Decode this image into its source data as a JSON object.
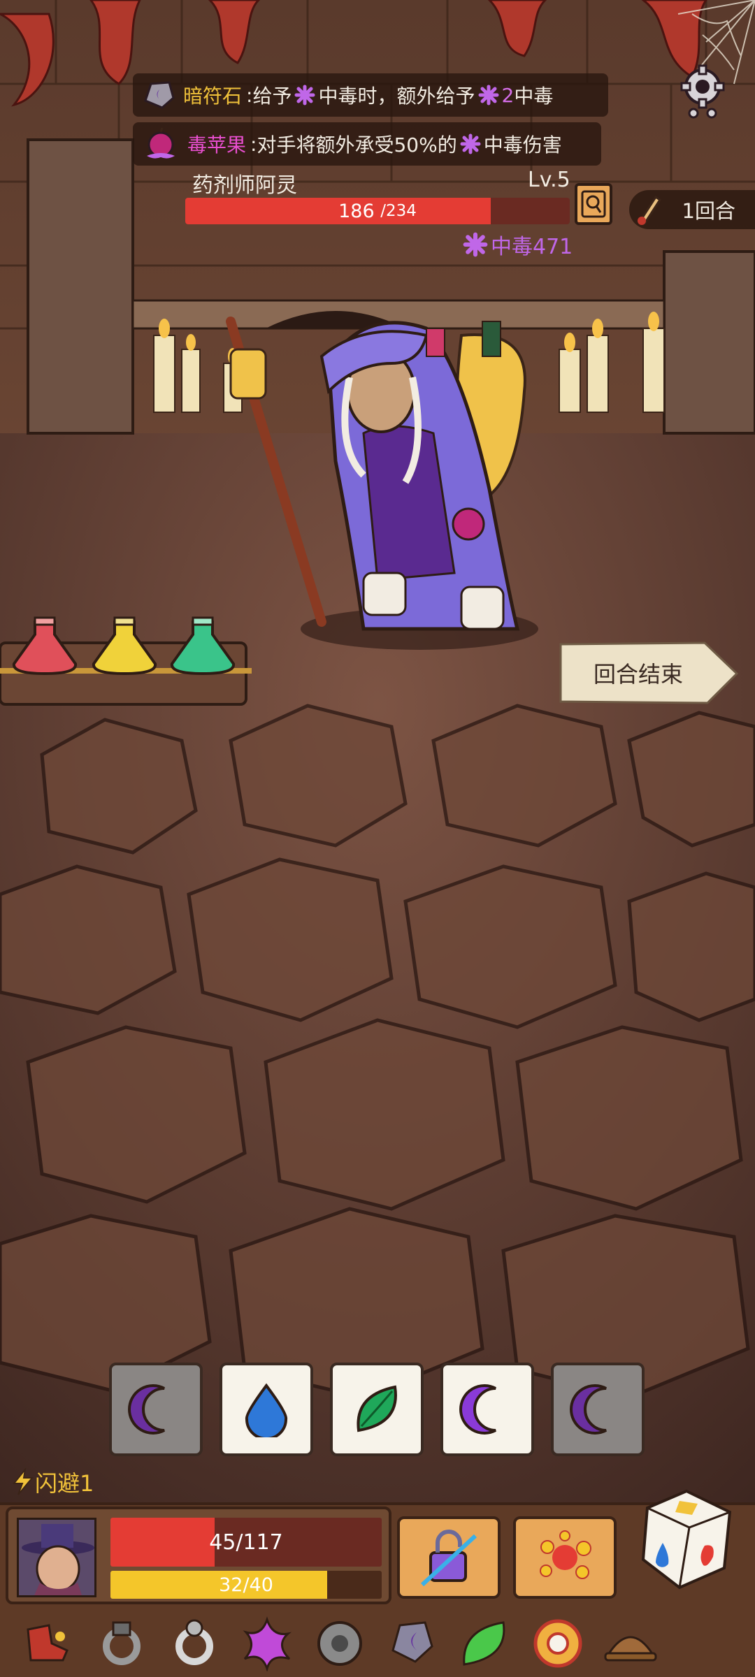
{
  "buffs": [
    {
      "name": "暗符石",
      "sep": ": ",
      "t1": "给予",
      "s1": "中毒",
      "t2": " 时，额外给予 ",
      "num": "2",
      "s2": " 中毒"
    },
    {
      "name": "毒苹果",
      "sep": ": ",
      "t1": "对手将额外承受50%的 ",
      "s1": "中毒",
      "t2": " 伤害"
    }
  ],
  "enemy": {
    "name": "药剂师阿灵",
    "level": "Lv.5",
    "hp_current": "186",
    "hp_max": "/234",
    "hp_fraction": 0.795,
    "status_label": "中毒471"
  },
  "round": {
    "label": "1回合"
  },
  "end_turn": {
    "label": "回合结束"
  },
  "potions": [
    "red",
    "yellow",
    "green"
  ],
  "dice": [
    {
      "face": "moon-purple",
      "state": "used"
    },
    {
      "face": "drop-blue",
      "state": "active"
    },
    {
      "face": "leaf-green",
      "state": "active"
    },
    {
      "face": "moon-purple",
      "state": "active"
    },
    {
      "face": "moon-purple",
      "state": "used"
    }
  ],
  "player": {
    "dodge": "闪避1",
    "hp_text": "45/117",
    "hp_fraction": 0.385,
    "energy_text": "32/40",
    "energy_fraction": 0.8
  },
  "relics": [
    "boot-icon",
    "ring-gray-icon",
    "ring-silver-icon",
    "poison-splash-icon",
    "gear-orb-icon",
    "moon-stone-icon",
    "leaf-icon",
    "target-orb-icon",
    "hat-icon"
  ],
  "colors": {
    "hp": "#e43c34",
    "energy": "#f4c62a",
    "poison": "#c067e8",
    "title_gold": "#f1c23a"
  }
}
